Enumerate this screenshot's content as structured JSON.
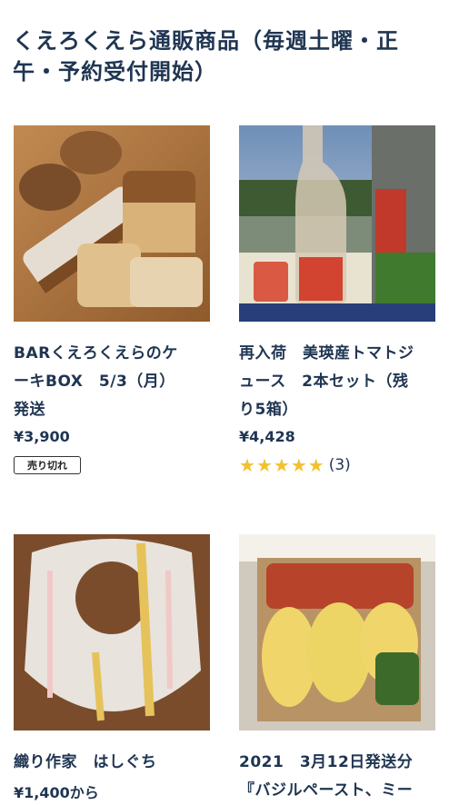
{
  "heading": "くえろくえら通販商品（毎週土曜・正午・予約受付開始）",
  "products": [
    {
      "title_lines": [
        "BARくえろくえらのケ",
        "ーキBOX　5/3（月）",
        "発送"
      ],
      "price": "¥3,900",
      "badge": "売り切れ",
      "image": "cakes-photo"
    },
    {
      "title_lines": [
        "再入荷　美瑛産トマトジ",
        "ュース　2本セット（残",
        "り5箱）"
      ],
      "price": "¥4,428",
      "rating": {
        "stars": 5,
        "count": "(3)"
      },
      "image": "tomato-juice-photo"
    },
    {
      "title_lines": [
        "織り作家　はしぐち"
      ],
      "price": "¥1,400から",
      "image": "bib-photo"
    },
    {
      "title_lines": [
        "2021　3月12日発送分",
        "『バジルペースト、ミー"
      ],
      "image": "pasta-box-photo"
    }
  ],
  "colors": {
    "text": "#1f3552",
    "star": "#f2c12e"
  }
}
